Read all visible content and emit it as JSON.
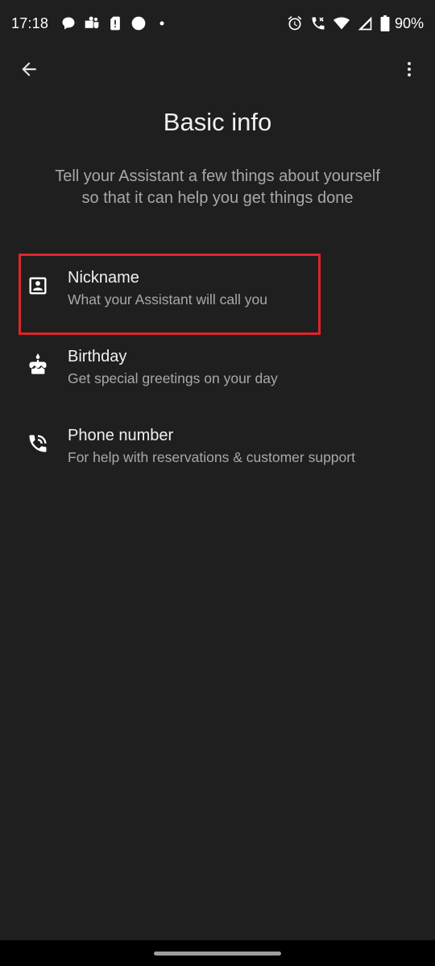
{
  "status_bar": {
    "time": "17:18",
    "battery": "90%",
    "left_icons": [
      "chat-bubble-icon",
      "teams-icon",
      "sim-alert-icon",
      "circle-notification-icon",
      "dot-icon"
    ],
    "right_icons": [
      "alarm-icon",
      "wifi-calling-icon",
      "wifi-icon",
      "signal-icon",
      "battery-icon"
    ]
  },
  "app_bar": {
    "back_icon": "arrow-back-icon",
    "more_icon": "more-vert-icon"
  },
  "page": {
    "title": "Basic info",
    "subtitle": "Tell your Assistant a few things about yourself so that it can help you get things done"
  },
  "items": [
    {
      "title": "Nickname",
      "description": "What your Assistant will call you",
      "icon": "contact-card-icon"
    },
    {
      "title": "Birthday",
      "description": "Get special greetings on your day",
      "icon": "cake-icon"
    },
    {
      "title": "Phone number",
      "description": "For help with reservations & customer support",
      "icon": "phone-icon"
    }
  ],
  "colors": {
    "background": "#1f1f1f",
    "highlight": "#e0242c",
    "primary_text": "#f1f1f1",
    "secondary_text": "#a8a8a8"
  }
}
